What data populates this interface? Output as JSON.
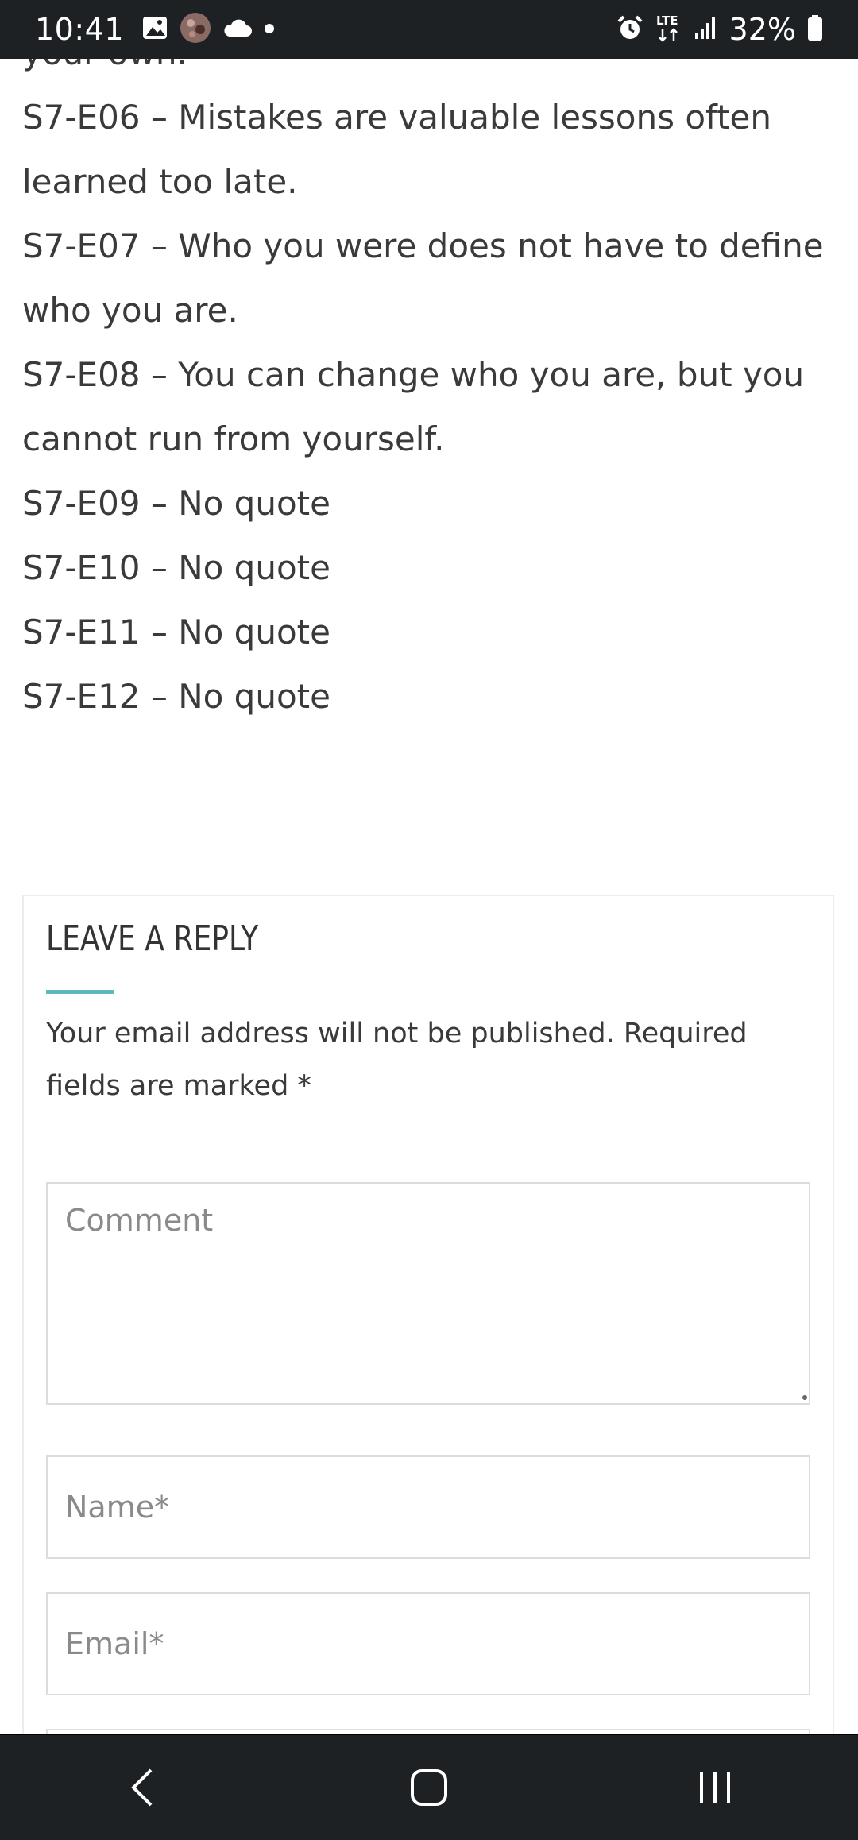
{
  "status_bar": {
    "time": "10:41",
    "battery": "32%",
    "network": "LTE",
    "left_icons": [
      "gallery-icon",
      "avatar-icon",
      "cloud-icon",
      "dot-icon"
    ],
    "right_icons": [
      "alarm-icon",
      "lte-icon",
      "signal-icon",
      "battery-icon"
    ]
  },
  "article": {
    "lines": [
      "your own.",
      "S7-E06 – Mistakes are valuable lessons often learned too late.",
      "S7-E07 – Who you were does not have to define who you are.",
      "S7-E08 – You can change who you are, but you cannot run from yourself.",
      "S7-E09 – No quote",
      "S7-E10 – No quote",
      "S7-E11 – No quote",
      "S7-E12 – No quote"
    ]
  },
  "reply": {
    "title": "LEAVE A REPLY",
    "note": "Your email address will not be published. Required fields are marked *",
    "accent_color": "#5ab9bc",
    "comment_placeholder": "Comment",
    "name_placeholder": "Name*",
    "email_placeholder": "Email*"
  },
  "nav_bar": {
    "buttons": [
      "back-icon",
      "home-icon",
      "recents-icon"
    ]
  }
}
